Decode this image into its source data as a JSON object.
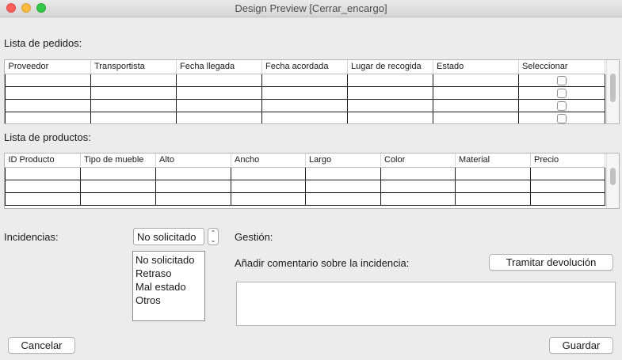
{
  "window": {
    "title": "Design Preview [Cerrar_encargo]"
  },
  "pedidos": {
    "label": "Lista de pedidos:",
    "columns": [
      "Proveedor",
      "Transportista",
      "Fecha llegada",
      "Fecha acordada",
      "Lugar de recogida",
      "Estado",
      "Seleccionar"
    ]
  },
  "productos": {
    "label": "Lista de productos:",
    "columns": [
      "ID Producto",
      "Tipo de mueble",
      "Alto",
      "Ancho",
      "Largo",
      "Color",
      "Material",
      "Precio"
    ]
  },
  "incidencias": {
    "label": "Incidencias:",
    "selected": "No solicitado",
    "options": [
      "No solicitado",
      "Retraso",
      "Mal estado",
      "Otros"
    ]
  },
  "gestion": {
    "label": "Gestión:",
    "comment_label": "Añadir comentario sobre la incidencia:",
    "comment_value": "",
    "tramitar_label": "Tramitar devolución"
  },
  "footer": {
    "cancel_label": "Cancelar",
    "save_label": "Guardar"
  }
}
